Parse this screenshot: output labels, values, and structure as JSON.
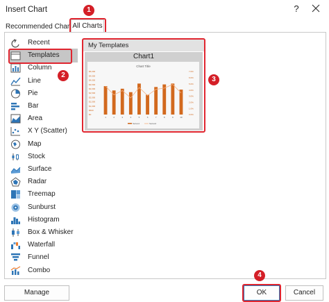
{
  "window": {
    "title": "Insert Chart",
    "help_label": "?"
  },
  "tabs": {
    "recommended": "Recommended Charts",
    "all": "All Charts"
  },
  "callouts": [
    "1",
    "2",
    "3",
    "4"
  ],
  "sidebar": {
    "items": [
      {
        "label": "Recent",
        "icon": "recent-icon"
      },
      {
        "label": "Templates",
        "icon": "templates-folder-icon",
        "selected": true
      },
      {
        "label": "Column",
        "icon": "column-chart-icon"
      },
      {
        "label": "Line",
        "icon": "line-chart-icon"
      },
      {
        "label": "Pie",
        "icon": "pie-chart-icon"
      },
      {
        "label": "Bar",
        "icon": "bar-chart-icon"
      },
      {
        "label": "Area",
        "icon": "area-chart-icon"
      },
      {
        "label": "X Y (Scatter)",
        "icon": "scatter-chart-icon"
      },
      {
        "label": "Map",
        "icon": "map-chart-icon"
      },
      {
        "label": "Stock",
        "icon": "stock-chart-icon"
      },
      {
        "label": "Surface",
        "icon": "surface-chart-icon"
      },
      {
        "label": "Radar",
        "icon": "radar-chart-icon"
      },
      {
        "label": "Treemap",
        "icon": "treemap-chart-icon"
      },
      {
        "label": "Sunburst",
        "icon": "sunburst-chart-icon"
      },
      {
        "label": "Histogram",
        "icon": "histogram-chart-icon"
      },
      {
        "label": "Box & Whisker",
        "icon": "box-whisker-chart-icon"
      },
      {
        "label": "Waterfall",
        "icon": "waterfall-chart-icon"
      },
      {
        "label": "Funnel",
        "icon": "funnel-chart-icon"
      },
      {
        "label": "Combo",
        "icon": "combo-chart-icon"
      }
    ]
  },
  "templates": {
    "header": "My Templates",
    "items": [
      {
        "name": "Chart1",
        "preview": {
          "title": "Chart Title",
          "left_ticks": [
            "$5,000",
            "$4,500",
            "$4,000",
            "$3,500",
            "$3,000",
            "$2,500",
            "$2,000",
            "$1,500",
            "$1,000",
            "$500",
            "$0"
          ],
          "right_ticks": [
            "7.0%",
            "6.0%",
            "5.0%",
            "4.0%",
            "3.0%",
            "2.0%",
            "1.0%",
            "0.0%"
          ],
          "x_ticks": [
            "1",
            "2",
            "3",
            "4",
            "5",
            "6",
            "7",
            "8",
            "9",
            "10"
          ],
          "bars": [
            3300,
            2800,
            3000,
            2600,
            3600,
            2300,
            3200,
            3500,
            3600,
            2900
          ],
          "line": [
            4.6,
            3.2,
            3.9,
            2.7,
            4.4,
            3.1,
            4.1,
            4.3,
            4.9,
            3.5
          ],
          "bar_color": "#d2691e",
          "line_color": "#f4b183",
          "legend": [
            "Series1",
            "Series2"
          ]
        }
      }
    ]
  },
  "footer": {
    "manage": "Manage Templates...",
    "ok": "OK",
    "cancel": "Cancel"
  },
  "colors": {
    "highlight": "#e0252f",
    "badge": "#d41f27",
    "selected_bg": "#c6c6c6",
    "accent": "#2e75b6"
  }
}
